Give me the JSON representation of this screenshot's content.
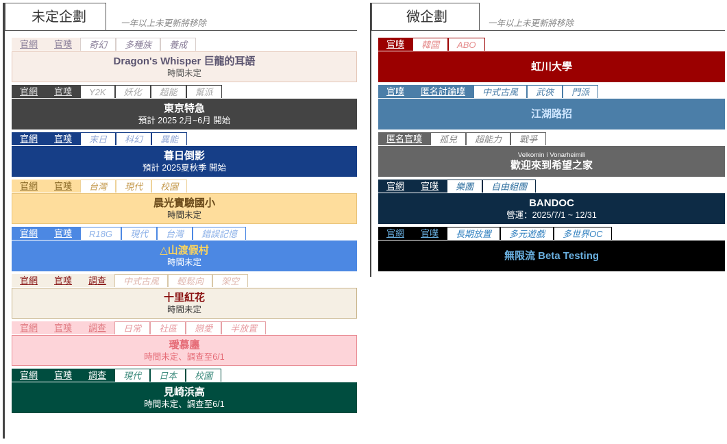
{
  "left": {
    "title": "未定企劃",
    "note": "一年以上未更新將移除",
    "entries": [
      {
        "links": [
          "官網",
          "官噗"
        ],
        "genres": [
          "奇幻",
          "多種族",
          "養成"
        ],
        "title": "Dragon's Whisper 巨龍的耳語",
        "sub": "時間未定",
        "colors": {
          "bar": "#f8eee8",
          "link": "#8a7f99",
          "genre": "#8a7f99",
          "gbg": "#fff",
          "gbd": "#d9cfcc",
          "box": "#f8eee8",
          "bd": "#e5c7b8",
          "title": "#5b5470",
          "sub": "#555"
        }
      },
      {
        "links": [
          "官網",
          "官噗"
        ],
        "genres": [
          "Y2K",
          "妖化",
          "超能",
          "幫派"
        ],
        "title": "東京特急",
        "sub": "預計 2025 2月~6月 開始",
        "colors": {
          "bar": "#444444",
          "link": "#dddddd",
          "genre": "#aaaaaa",
          "gbg": "#fff",
          "gbd": "#444",
          "box": "#444444",
          "bd": "#444",
          "title": "#ffffff",
          "sub": "#ffffff"
        }
      },
      {
        "links": [
          "官網",
          "官噗"
        ],
        "genres": [
          "末日",
          "科幻",
          "異能"
        ],
        "title": "暮日倒影",
        "sub": "預計 2025夏秋季 開始",
        "colors": {
          "bar": "#163e87",
          "link": "#ffffff",
          "genre": "#8fa6d6",
          "gbg": "#fff",
          "gbd": "#163e87",
          "box": "#163e87",
          "bd": "#163e87",
          "title": "#ffffff",
          "sub": "#ffffff",
          "tparts": [
            {
              "t": "暮日",
              "c": "#ffffff"
            },
            {
              "t": "倒影",
              "c": "#ffffff"
            }
          ]
        }
      },
      {
        "links": [
          "官網",
          "官噗"
        ],
        "genres": [
          "台灣",
          "現代",
          "校園"
        ],
        "title": "晨光實驗國小",
        "sub": "時間未定",
        "colors": {
          "bar": "#fedd9c",
          "link": "#8b6b28",
          "genre": "#c59a4e",
          "gbg": "#fff",
          "gbd": "#eed29a",
          "box": "#fedd9c",
          "bd": "#e8c278",
          "title": "#6a4a1a",
          "sub": "#333"
        }
      },
      {
        "links": [
          "官網",
          "官噗"
        ],
        "genres": [
          "R18G",
          "現代",
          "台灣",
          "錯誤記憶"
        ],
        "title": "△山渡假村",
        "sub": "時間未定",
        "colors": {
          "bar": "#4c88e3",
          "link": "#ffffff",
          "genre": "#8eb2e8",
          "gbg": "#fff",
          "gbd": "#4c88e3",
          "box": "#4c88e3",
          "bd": "#4c88e3",
          "title": "#ffd65a",
          "sub": "#ffffff"
        }
      },
      {
        "links": [
          "官網",
          "官噗",
          "調查"
        ],
        "genres": [
          "中式古風",
          "輕鬆向",
          "架空"
        ],
        "title": "十里紅花",
        "sub": "時間未定",
        "colors": {
          "bar": "#f5efe4",
          "link": "#8a1b1b",
          "genre": "#e0b8b0",
          "gbg": "#fff",
          "gbd": "#d9c8a8",
          "box": "#f5efe4",
          "bd": "#c8b48a",
          "title": "#8a1010",
          "sub": "#333"
        }
      },
      {
        "links": [
          "官網",
          "官噗",
          "調查"
        ],
        "genres": [
          "日常",
          "社區",
          "戀愛",
          "半放置"
        ],
        "title": "璦慕廛",
        "sub": "時間未定、調查至6/1",
        "colors": {
          "bar": "#fdd4d9",
          "link": "#e07b82",
          "genre": "#e79aa0",
          "gbg": "#fff",
          "gbd": "#e6a1a6",
          "box": "#fdd4d9",
          "bd": "#e98d95",
          "title": "#e56a75",
          "sub": "#e56a75"
        }
      },
      {
        "links": [
          "官網",
          "官噗",
          "調查"
        ],
        "genres": [
          "現代",
          "日本",
          "校園"
        ],
        "title": "見崎浜高",
        "sub": "時間未定、調查至6/1",
        "colors": {
          "bar": "#004d3f",
          "link": "#ffffff",
          "genre": "#3c8a7c",
          "gbg": "#fff",
          "gbd": "#004d3f",
          "box": "#004d3f",
          "bd": "#004d3f",
          "title": "#ffffff",
          "sub": "#ffffff"
        }
      }
    ]
  },
  "right": {
    "title": "微企劃",
    "note": "一年以上未更新將移除",
    "entries": [
      {
        "links": [
          "官噗"
        ],
        "genres": [
          "韓國",
          "ABO"
        ],
        "title": "虹川大學",
        "sub": "",
        "pre": "",
        "colors": {
          "bar": "#9b0000",
          "link": "#ffffff",
          "genre": "#e58c8c",
          "gbg": "#fff",
          "gbd": "#9b0000",
          "box": "#9b0000",
          "bd": "#9b0000",
          "title": "#ffffff",
          "sub": "#ffffff"
        }
      },
      {
        "links": [
          "官噗",
          "匿名討論噗"
        ],
        "genres": [
          "中式古風",
          "武俠",
          "門派"
        ],
        "title": "江湖路招",
        "sub": "",
        "pre": "",
        "colors": {
          "bar": "#4b7ea8",
          "link": "#ffffff",
          "genre": "#4b7ea8",
          "gbg": "#fff",
          "gbd": "#4b7ea8",
          "box": "#4b7ea8",
          "bd": "#4b7ea8",
          "title": "#cfe6ff",
          "sub": "#ffffff"
        }
      },
      {
        "links": [
          "匿名官噗"
        ],
        "genres": [
          "孤兒",
          "超能力",
          "戰爭"
        ],
        "title": "歡迎來到希望之家",
        "sub": "",
        "pre": "Velkomin í Vonarheimili",
        "colors": {
          "bar": "#666666",
          "link": "#ffffff",
          "genre": "#888888",
          "gbg": "#fff",
          "gbd": "#666",
          "box": "#666666",
          "bd": "#666",
          "title": "#ffffff",
          "sub": "#ffffff"
        }
      },
      {
        "links": [
          "官網",
          "官噗"
        ],
        "genres": [
          "樂團",
          "自由組團"
        ],
        "title": "BANDOC",
        "sub": "營運：2025/7/1 ~ 12/31",
        "pre": "",
        "colors": {
          "bar": "#0d2b45",
          "link": "#ffffff",
          "genre": "#2f6f9f",
          "gbg": "#fff",
          "gbd": "#0d2b45",
          "box": "#0d2b45",
          "bd": "#0d2b45",
          "title": "#ffffff",
          "sub": "#ffffff"
        }
      },
      {
        "links": [
          "官網",
          "官噗"
        ],
        "genres": [
          "長期放置",
          "多元遊戲",
          "多世界OC"
        ],
        "title": "無限流 Beta Testing",
        "sub": "",
        "pre": "",
        "colors": {
          "bar": "#000000",
          "link": "#6ab0e0",
          "genre": "#2f7fbf",
          "gbg": "#fff",
          "gbd": "#000",
          "box": "#000000",
          "bd": "#000",
          "title": "#6ab0e0",
          "sub": "#ffffff"
        }
      }
    ]
  }
}
